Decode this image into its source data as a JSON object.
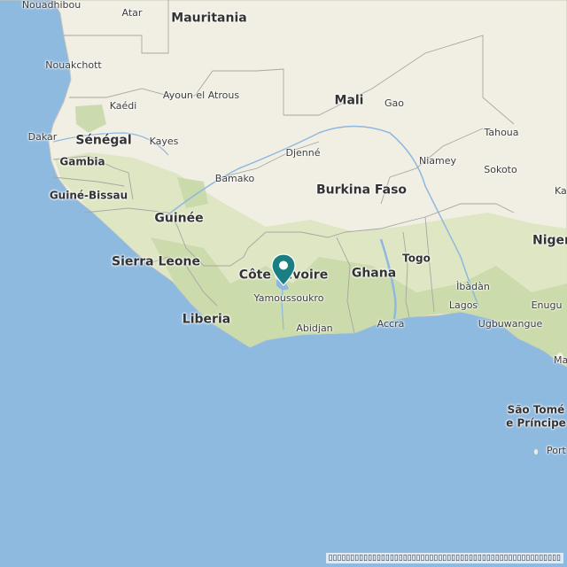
{
  "map": {
    "countries": {
      "mauritania": "Mauritania",
      "mali": "Mali",
      "senegal": "Sénégal",
      "gambia": "Gambia",
      "guinea_bissau": "Guiné-Bissau",
      "guinea": "Guinée",
      "sierra_leone": "Sierra Leone",
      "liberia": "Liberia",
      "cote_divoire": "Côte d'Ivoire",
      "burkina_faso": "Burkina Faso",
      "ghana": "Ghana",
      "togo": "Togo",
      "nigeria": "Niger",
      "sao_tome_1": "São Tomé",
      "sao_tome_2": "e Príncipe"
    },
    "cities": {
      "nouadhibou": "Nouadhibou",
      "atar": "Atar",
      "nouakchott": "Nouakchott",
      "ayoun": "Ayoun el Atrous",
      "kaedi": "Kaédi",
      "gao": "Gao",
      "dakar": "Dakar",
      "kayes": "Kayes",
      "tahoua": "Tahoua",
      "djenne": "Djenné",
      "niamey": "Niamey",
      "sokoto": "Sokoto",
      "kano": "Ka",
      "bamako": "Bamako",
      "yamoussoukro": "Yamoussoukro",
      "abidjan": "Abidjan",
      "accra": "Accra",
      "lagos": "Lagos",
      "ibadan": "Ìbàdàn",
      "enugu": "Enugu",
      "ugbuwangue": "Ugbuwangue",
      "malabo": "Ma",
      "port": "Port"
    },
    "marker": {
      "color": "#1a7e82"
    },
    "attribution": "▯▯▯▯▯▯▯▯▯▯▯▯▯▯▯▯▯▯▯▯▯▯▯▯▯▯▯▯▯▯▯▯▯▯▯▯▯▯▯▯▯▯▯▯▯▯▯▯▯▯▯▯▯"
  }
}
